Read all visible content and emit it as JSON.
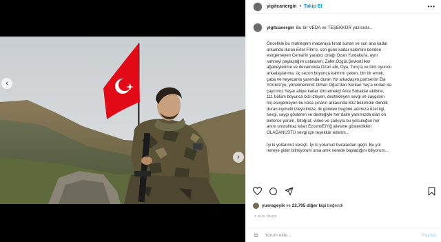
{
  "post": {
    "username": "yigitcanergin",
    "follow_label": "Takip Et",
    "separator": "•",
    "more_label": "•••"
  },
  "caption": {
    "username": "yigitcanergin",
    "first_line": "Bu bir VEDA ve TEŞEKKÜR yazısıdır...",
    "paragraph1": [
      "Öncelikle bu muhteşem maceraya fırsat sunan ve son ana kadar",
      "arkamda duran Erler Film'e, son güne kadar kalemini benden",
      "esirgemeyen Cemal'in yaratıcı ortağı Ozan Yurdakul'a, aynı",
      "sahneyi paylaştığım ustalarım; Zafer,Özgür,Şevket,İlker",
      "ağabeylerime ve devamında Ozan abi, Oya, Tunç'a ve tüm oyuncu",
      "arkadaşlarıma, üç sezon boyunca kahrımı çeken, bin bir emek,",
      "çaba ve heyecanla yanımda duran Yol arkadaşım,partnerim Ela",
      "Yörüklü'ye, yönetmenimiz Orhan Oğuz'dan Serkan Yaş'a ondan da",
      "çaycımız Yaşar abiye kadar tüm emekçi Arka Sokaklar ekibine,",
      "111 bölüm boyunca bizi izleyen, destekleyen sevgi ve saygısını",
      "hiç esirgemeyen bu koca çınarın arkasında 632 bölümdür dimdik",
      "duran kıymetli izleyicimize, ilk günden bugüne adımıza özel ilgi,",
      "sevgi, saygı gösteren ve desteğiyle her daim yanımızda olan on",
      "binlerce yorum, fotoğraf, video ve şarkıyla bu yolculuğun her",
      "anını unutulmaz kılan Ezcem/EiYiğ ailesine gösterdikleri",
      "OLAĞANÜSTÜ sevgi için teşekkür ederim..."
    ],
    "paragraph2": [
      "İyi ki yollarımız kesişti. İyi ki yolumuz buralardan geçti. Bu yol",
      "nereye gider bilmiyorum ama artık nerede başladığını biliyorum..."
    ]
  },
  "likes": {
    "user": "yusrageyik",
    "connector": "ve",
    "others": "22,795 diğer kişi",
    "suffix": "beğendi"
  },
  "time_ago": "2 GÜN ÖNCE",
  "comment": {
    "emoji": "☺",
    "placeholder": "Yorum ekle...",
    "post_label": "Paylaş"
  },
  "nav": {
    "left_arrow": "‹",
    "right_arrow": "›"
  },
  "carousel": {
    "count": 3,
    "active_index": 0
  },
  "colors": {
    "link_blue": "#0095f6",
    "post_disabled": "#b3dbff",
    "flag_red": "#e30a17",
    "muted_gray": "#8e8e8e"
  }
}
